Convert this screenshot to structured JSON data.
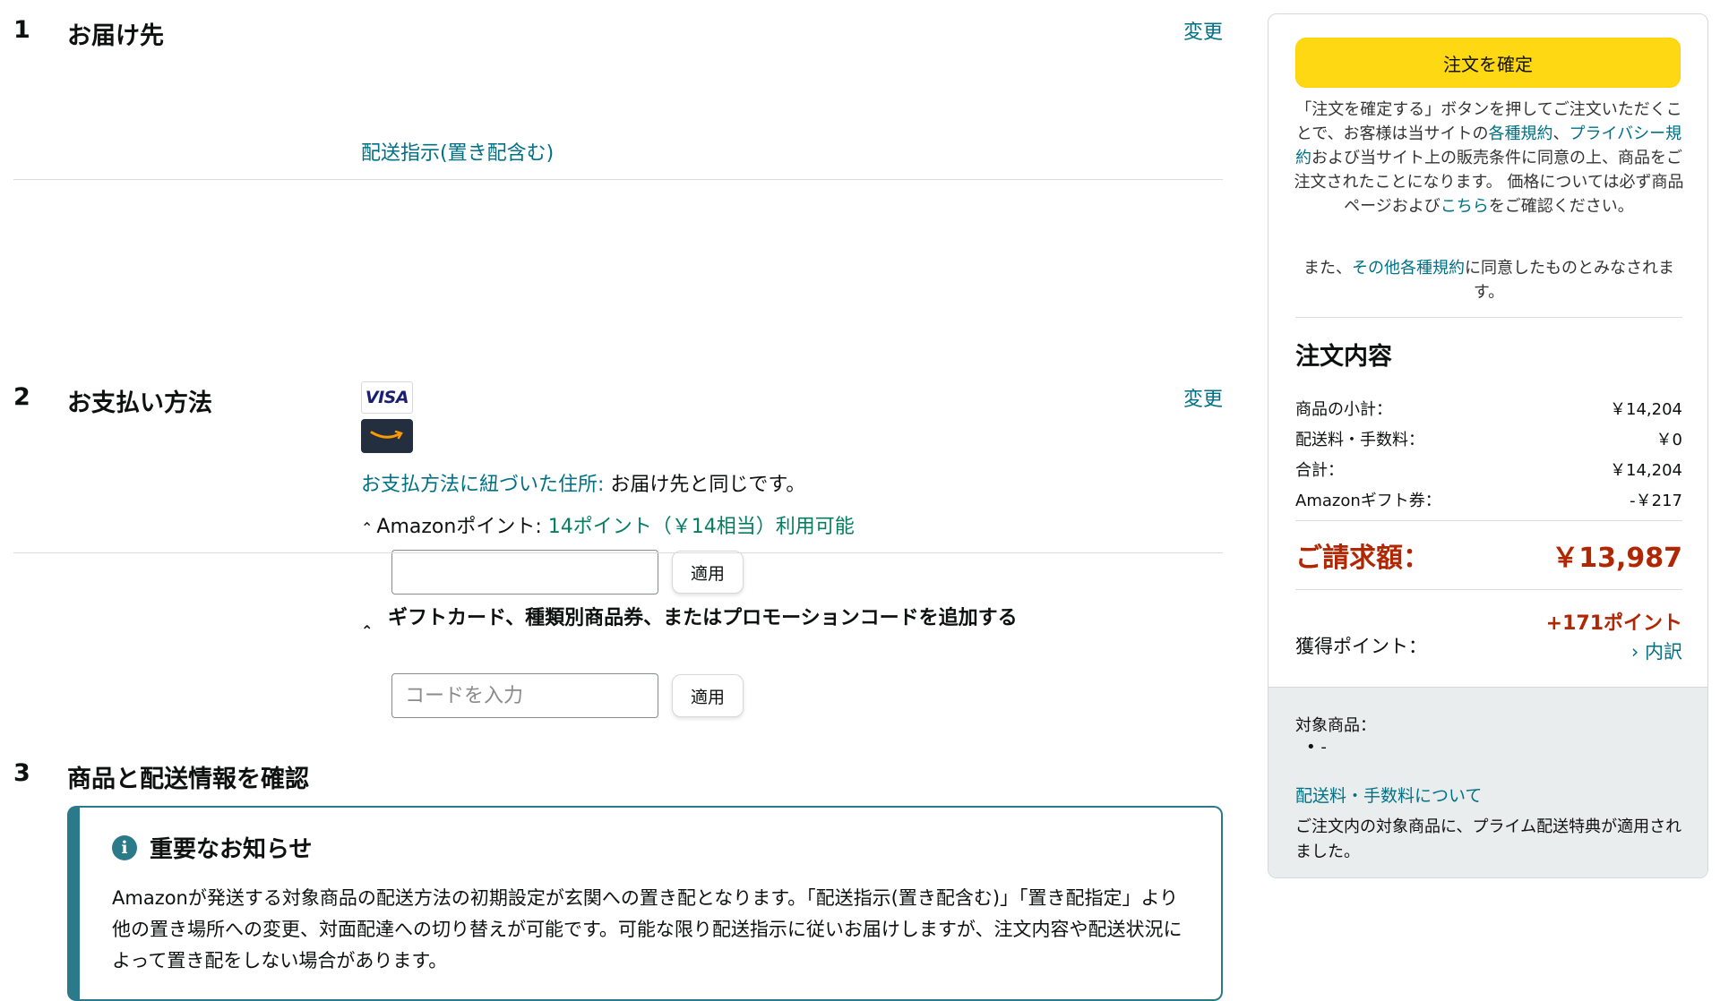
{
  "colors": {
    "link": "#007185",
    "accent_button": "#ffd814",
    "price_red": "#b12704",
    "points_green": "#067d62",
    "notice_teal": "#2b7a8a"
  },
  "sections": {
    "delivery": {
      "number": "1",
      "title": "お届け先",
      "change_label": "変更",
      "instructions_link": "配送指示(置き配含む)"
    },
    "payment": {
      "number": "2",
      "title": "お支払い方法",
      "change_label": "変更",
      "visa_label": "VISA",
      "amazon_card_icon": "amazon-smile-card-icon",
      "billing_link": "お支払方法に紐づいた住所:",
      "billing_text": " お届け先と同じです。",
      "points_label": "Amazonポイント: ",
      "points_available": "14ポイント（￥14相当）利用可能",
      "points_input_value": "",
      "apply_label": "適用",
      "gift_label": "ギフトカード、種類別商品券、またはプロモーションコードを追加する",
      "code_placeholder": "コードを入力",
      "apply_label_2": "適用"
    },
    "review": {
      "number": "3",
      "title": "商品と配送情報を確認",
      "notice_title": "重要なお知らせ",
      "notice_body": "Amazonが発送する対象商品の配送方法の初期設定が玄関への置き配となります。「配送指示(置き配含む)」「置き配指定」より他の置き場所への変更、対面配達への切り替えが可能です。可能な限り配送指示に従いお届けしますが、注文内容や配送状況によって置き配をしない場合があります。"
    }
  },
  "summary": {
    "place_order_label": "注文を確定",
    "terms_part1": "「注文を確定する」ボタンを押してご注文いただくことで、お客様は当サイトの",
    "terms_link1": "各種規約",
    "terms_part2": "、",
    "terms_link2": "プライバシー規約",
    "terms_part3": "および当サイト上の販売条件に同意の上、商品をご注文されたことになります。 価格については必ず商品ページおよび",
    "terms_link3": "こちら",
    "terms_part4": "をご確認ください。",
    "terms2_part1": "また、",
    "terms2_link": "その他各種規約",
    "terms2_part2": "に同意したものとみなされます。",
    "order_title": "注文内容",
    "rows": [
      {
        "label": "商品の小計：",
        "value": "￥14,204"
      },
      {
        "label": "配送料・手数料：",
        "value": "￥0"
      },
      {
        "label": "合計：",
        "value": "￥14,204"
      },
      {
        "label": "Amazonギフト券：",
        "value": "-￥217"
      }
    ],
    "total_label": "ご請求額：",
    "total_value": "￥13,987",
    "points_label": "獲得ポイント：",
    "points_value": "+171ポイント",
    "points_detail": "› 内訳",
    "eligible_label": "対象商品：",
    "eligible_bullet": "•  -",
    "shipping_fee_link": "配送料・手数料について",
    "prime_note": "ご注文内の対象商品に、プライム配送特典が適用されました。"
  }
}
